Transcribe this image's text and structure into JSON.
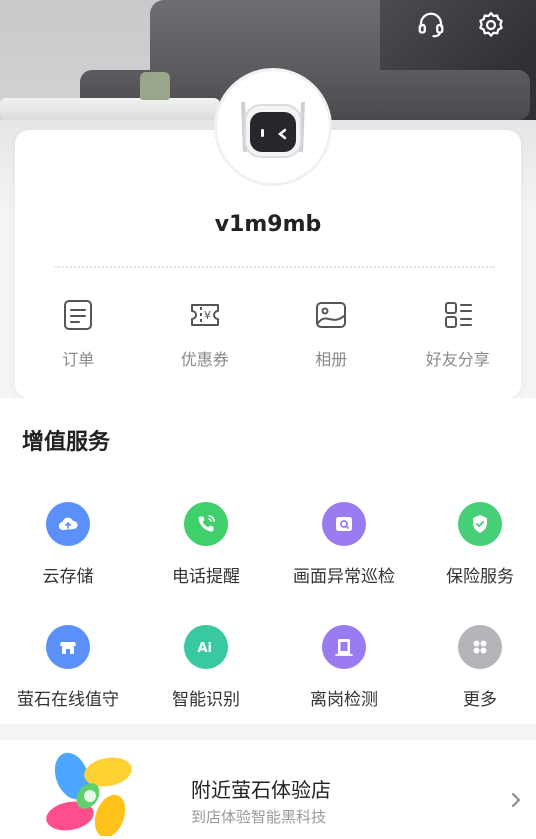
{
  "header": {
    "support_icon": "headset-icon",
    "settings_icon": "gear-icon"
  },
  "profile": {
    "username": "v1m9mb",
    "avatar_icon": "robot-avatar-icon"
  },
  "quick_actions": [
    {
      "label": "订单",
      "icon": "order-list-icon"
    },
    {
      "label": "优惠券",
      "icon": "coupon-icon"
    },
    {
      "label": "相册",
      "icon": "album-icon"
    },
    {
      "label": "好友分享",
      "icon": "share-grid-icon"
    }
  ],
  "services": {
    "title": "增值服务",
    "items": [
      {
        "label": "云存储",
        "icon": "cloud-upload-icon",
        "color": "#5b8ff9"
      },
      {
        "label": "电话提醒",
        "icon": "phone-icon",
        "color": "#3fcf6b"
      },
      {
        "label": "画面异常巡检",
        "icon": "camera-frame-icon",
        "color": "#9b7cf0"
      },
      {
        "label": "保险服务",
        "icon": "shield-check-icon",
        "color": "#47cf78"
      },
      {
        "label": "萤石在线值守",
        "icon": "store-icon",
        "color": "#5b8ff9"
      },
      {
        "label": "智能识别",
        "icon": "ai-icon",
        "color": "#39c9a1"
      },
      {
        "label": "离岗检测",
        "icon": "door-icon",
        "color": "#9b7cf0"
      },
      {
        "label": "更多",
        "icon": "more-grid-icon",
        "color": "#b5b5b9"
      }
    ]
  },
  "nearby_store": {
    "title": "附近萤石体验店",
    "subtitle": "到店体验智能黑科技",
    "logo": "ezviz-logo",
    "chevron": "chevron-right-icon"
  }
}
